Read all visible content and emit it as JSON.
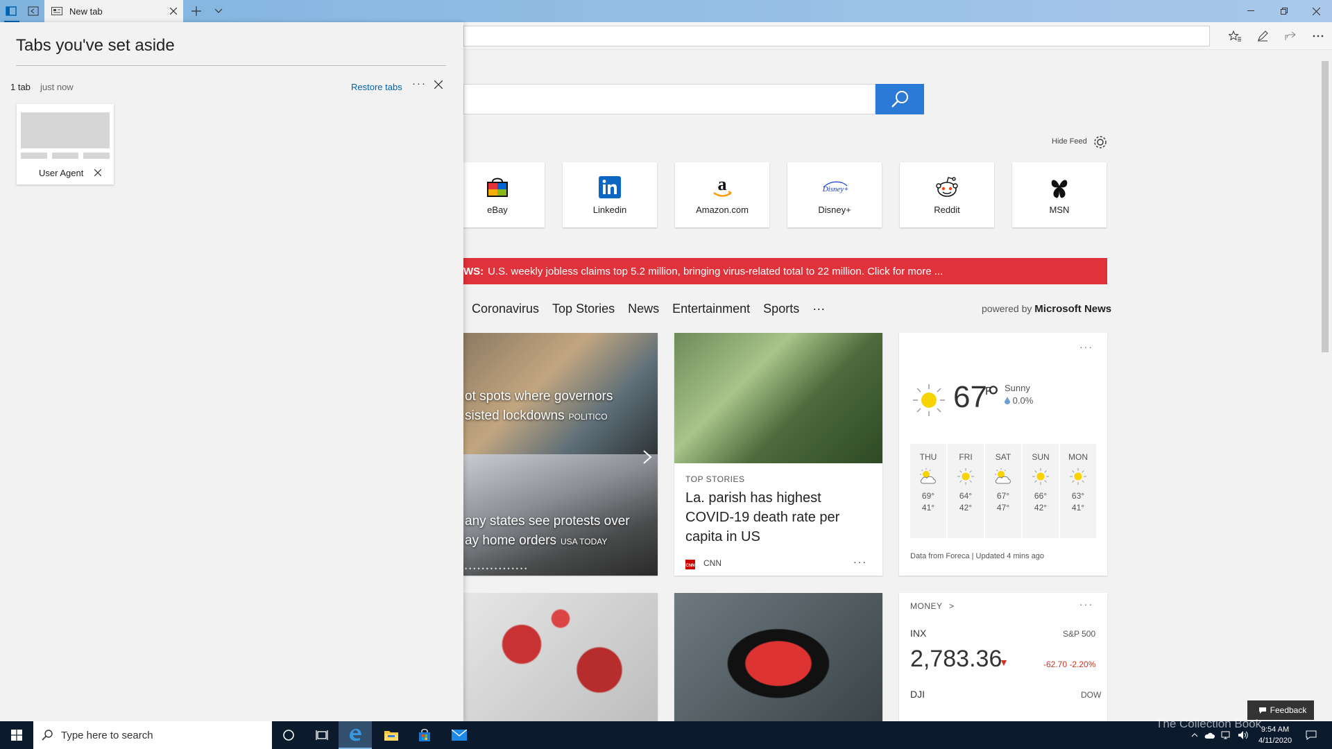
{
  "titlebar": {
    "tab_title": "New tab"
  },
  "aside": {
    "title": "Tabs you've set aside",
    "count": "1 tab",
    "time": "just now",
    "restore_label": "Restore tabs",
    "more": "···",
    "thumbnail": {
      "label": "User Agent"
    }
  },
  "page": {
    "hide_feed": "Hide Feed",
    "tiles": [
      "eBay",
      "Linkedin",
      "Amazon.com",
      "Disney+",
      "Reddit",
      "MSN"
    ],
    "breaking": {
      "prefix": "WS:",
      "text": "U.S. weekly jobless claims top 5.2 million, bringing virus-related total to 22 million. Click for more ..."
    },
    "nav": [
      "Coronavirus",
      "Top Stories",
      "News",
      "Entertainment",
      "Sports",
      "···"
    ],
    "powered_prefix": "powered by",
    "powered_brand": "Microsoft News",
    "hero": {
      "story1_line1": "ot spots where governors",
      "story1_line2": "sisted lockdowns",
      "story1_src": "POLITICO",
      "story2_line1": "any states see protests over",
      "story2_line2": "ay home orders",
      "story2_src": "USA TODAY",
      "dots": "•••••••••••••••"
    },
    "card2": {
      "kicker": "TOP STORIES",
      "headline": "La. parish has highest COVID-19 death rate per capita in US",
      "source": "CNN",
      "more": "···"
    },
    "weather": {
      "temp": "67°",
      "unit": "F",
      "condition": "Sunny",
      "precip": "0.0%",
      "more": "···",
      "forecast": [
        {
          "day": "THU",
          "hi": "69°",
          "lo": "41°",
          "icon": "partly-cloudy-icon"
        },
        {
          "day": "FRI",
          "hi": "64°",
          "lo": "42°",
          "icon": "sun-icon"
        },
        {
          "day": "SAT",
          "hi": "67°",
          "lo": "47°",
          "icon": "partly-cloudy-icon"
        },
        {
          "day": "SUN",
          "hi": "66°",
          "lo": "42°",
          "icon": "sun-icon"
        },
        {
          "day": "MON",
          "hi": "63°",
          "lo": "41°",
          "icon": "sun-icon"
        }
      ],
      "footer": "Data from Foreca | Updated 4 mins ago"
    },
    "money": {
      "label": "MONEY",
      "chev": ">",
      "more": "···",
      "symbol1": "INX",
      "index1": "S&P 500",
      "value1": "2,783.36",
      "change1": "-62.70  -2.20%",
      "symbol2": "DJI",
      "index2": "DOW"
    },
    "feedback": "Feedback"
  },
  "taskbar": {
    "search_placeholder": "Type here to search",
    "time": "9:54 AM",
    "date": "4/11/2020"
  },
  "watermark": "The Collection Book",
  "colors": {
    "accent": "#2b7bd6",
    "breaking": "#e0323a",
    "link": "#0063b1",
    "down": "#cc3322"
  }
}
